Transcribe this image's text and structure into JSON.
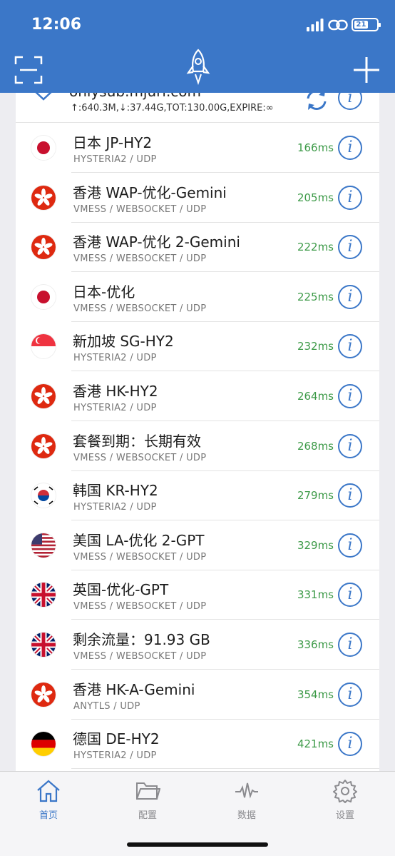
{
  "status_bar": {
    "time": "12:06",
    "battery": "21"
  },
  "nav": {
    "left_icon": "scan-icon",
    "center_icon": "rocket-icon",
    "right_icon": "plus-icon"
  },
  "subscription": {
    "url": "onlysub.mjurl.com",
    "stats": "↑:640.3M,↓:37.44G,TOT:130.00G,EXPIRE:∞"
  },
  "servers": [
    {
      "flag": "JP",
      "name": "日本 JP-HY2",
      "protocol": "HYSTERIA2 / UDP",
      "latency": "166ms"
    },
    {
      "flag": "HK",
      "name": "香港 WAP-优化-Gemini",
      "protocol": "VMESS / WEBSOCKET / UDP",
      "latency": "205ms"
    },
    {
      "flag": "HK",
      "name": "香港 WAP-优化 2-Gemini",
      "protocol": "VMESS / WEBSOCKET / UDP",
      "latency": "222ms"
    },
    {
      "flag": "JP",
      "name": "日本-优化",
      "protocol": "VMESS / WEBSOCKET / UDP",
      "latency": "225ms"
    },
    {
      "flag": "SG",
      "name": "新加坡 SG-HY2",
      "protocol": "HYSTERIA2 / UDP",
      "latency": "232ms"
    },
    {
      "flag": "HK",
      "name": "香港 HK-HY2",
      "protocol": "HYSTERIA2 / UDP",
      "latency": "264ms"
    },
    {
      "flag": "HK",
      "name": "套餐到期：长期有效",
      "protocol": "VMESS / WEBSOCKET / UDP",
      "latency": "268ms"
    },
    {
      "flag": "KR",
      "name": "韩国 KR-HY2",
      "protocol": "HYSTERIA2 / UDP",
      "latency": "279ms"
    },
    {
      "flag": "US",
      "name": "美国 LA-优化 2-GPT",
      "protocol": "VMESS / WEBSOCKET / UDP",
      "latency": "329ms"
    },
    {
      "flag": "GB",
      "name": "英国-优化-GPT",
      "protocol": "VMESS / WEBSOCKET / UDP",
      "latency": "331ms"
    },
    {
      "flag": "GB",
      "name": "剩余流量：91.93 GB",
      "protocol": "VMESS / WEBSOCKET / UDP",
      "latency": "336ms"
    },
    {
      "flag": "HK",
      "name": "香港 HK-A-Gemini",
      "protocol": "ANYTLS / UDP",
      "latency": "354ms"
    },
    {
      "flag": "DE",
      "name": "德国 DE-HY2",
      "protocol": "HYSTERIA2 / UDP",
      "latency": "421ms"
    }
  ],
  "tabs": [
    {
      "label": "首页",
      "icon": "home-icon",
      "active": true
    },
    {
      "label": "配置",
      "icon": "folder-icon",
      "active": false
    },
    {
      "label": "数据",
      "icon": "activity-icon",
      "active": false
    },
    {
      "label": "设置",
      "icon": "gear-icon",
      "active": false
    }
  ],
  "colors": {
    "accent": "#3b77c8",
    "latency": "#3d9a48",
    "header": "#3b77c8"
  }
}
